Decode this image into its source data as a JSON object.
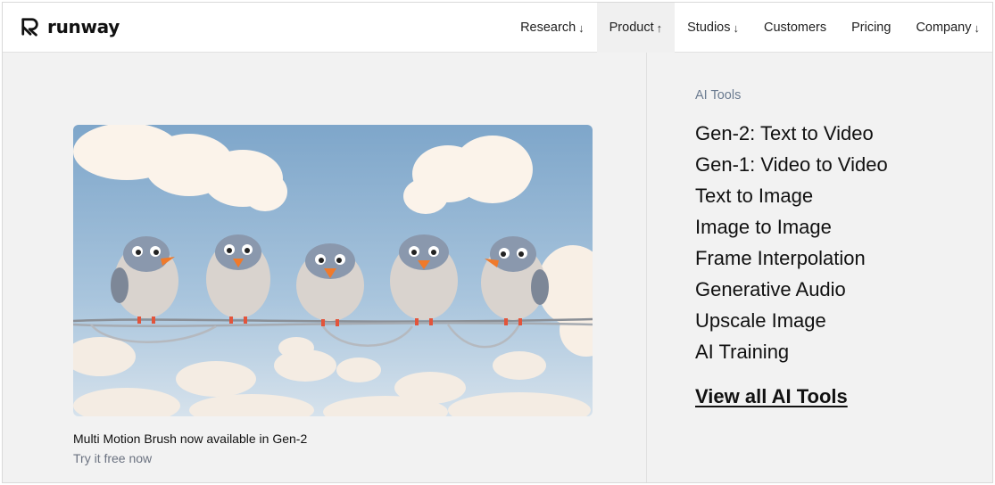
{
  "brand": {
    "name": "runway"
  },
  "nav": {
    "items": [
      {
        "label": "Research",
        "arrow": "↓"
      },
      {
        "label": "Product",
        "arrow": "↑"
      },
      {
        "label": "Studios",
        "arrow": "↓"
      },
      {
        "label": "Customers",
        "arrow": ""
      },
      {
        "label": "Pricing",
        "arrow": ""
      },
      {
        "label": "Company",
        "arrow": "↓"
      }
    ],
    "active": "Product"
  },
  "feature": {
    "caption": "Multi Motion Brush now available in Gen-2",
    "link": "Try it free now",
    "image_colors": {
      "sky_top": "#8fb2d2",
      "sky_bottom": "#c9dbea",
      "cloud": "#fbf4ec",
      "bird_body": "#d8d2cc",
      "bird_head": "#8a97ab",
      "beak": "#f07a2b"
    }
  },
  "tools": {
    "heading": "AI Tools",
    "items": [
      "Gen-2: Text to Video",
      "Gen-1: Video to Video",
      "Text to Image",
      "Image to Image",
      "Frame Interpolation",
      "Generative Audio",
      "Upscale Image",
      "AI Training"
    ],
    "view_all": "View all AI Tools"
  }
}
